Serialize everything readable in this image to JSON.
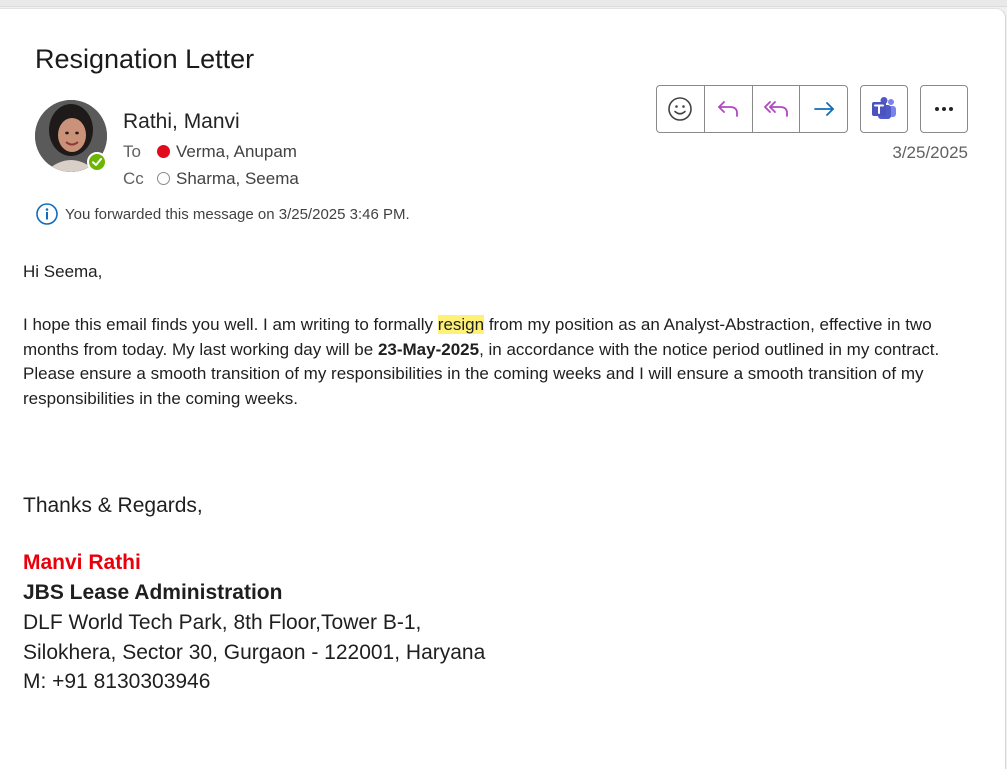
{
  "email": {
    "subject": "Resignation Letter",
    "sender": "Rathi, Manvi",
    "to_label": "To",
    "to_name": "Verma, Anupam",
    "cc_label": "Cc",
    "cc_name": "Sharma, Seema",
    "date": "3/25/2025",
    "info": "You forwarded this message on 3/25/2025 3:46 PM."
  },
  "toolbar": {
    "icons": [
      "emoji-icon",
      "reply-icon",
      "reply-all-icon",
      "forward-icon",
      "teams-icon",
      "more-icon"
    ]
  },
  "body": {
    "greeting": "Hi Seema,",
    "p1_a": "I hope this email finds you well. I am writing to formally ",
    "p1_highlight": "resign",
    "p1_b": " from my position as an Analyst-Abstraction, effective in two months from today. My last working day will be ",
    "p1_date": "23-May-2025",
    "p1_c": ", in accordance with the notice period outlined in my contract. Please ensure a smooth transition of my responsibilities in the coming weeks and I will ensure a smooth transition of my responsibilities in the coming weeks.",
    "closing": "Thanks & Regards,"
  },
  "signature": {
    "name": "Manvi Rathi",
    "org": "JBS Lease Administration",
    "address1": "DLF World Tech Park, 8th Floor,Tower B-1,",
    "address2": "Silokhera, Sector 30, Gurgaon - 122001, Haryana",
    "phone": "M: +91 8130303946"
  },
  "colors": {
    "accent_purple": "#b146c2",
    "accent_blue": "#0f6cbd",
    "presence_green": "#6bb700",
    "busy_red": "#e00b1c",
    "signature_red": "#e8000b",
    "highlight_yellow": "#fff176"
  }
}
